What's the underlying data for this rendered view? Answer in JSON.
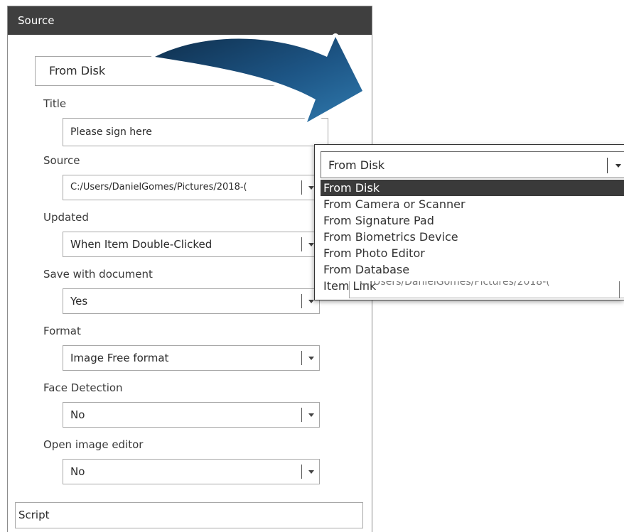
{
  "panel": {
    "header": "Source",
    "mode": "From Disk",
    "script_label": "Script",
    "fields": [
      {
        "label": "Title",
        "value": "Please sign here"
      },
      {
        "label": "Source",
        "value": "C:/Users/DanielGomes/Pictures/2018-("
      },
      {
        "label": "Updated",
        "value": "When Item Double-Clicked"
      },
      {
        "label": "Save with document",
        "value": "Yes"
      },
      {
        "label": "Format",
        "value": "Image Free format"
      },
      {
        "label": "Face Detection",
        "value": "No"
      },
      {
        "label": "Open image editor",
        "value": "No"
      }
    ]
  },
  "popup": {
    "selected": "From Disk",
    "options": [
      "From Disk",
      "From Camera or Scanner",
      "From Signature Pad",
      "From Biometrics Device",
      "From Photo Editor",
      "From Database",
      "Item Link"
    ],
    "behind_text": "C:/Users/DanielGomes/Pictures/2018-("
  },
  "colors": {
    "header_bg": "#3f3f3f",
    "selected_bg": "#3a3a3a",
    "arrow_dark": "#123a5c",
    "arrow_light": "#2a6fa1"
  },
  "icons": [
    "dropdown-arrow-icon",
    "curved-arrow-graphic"
  ]
}
